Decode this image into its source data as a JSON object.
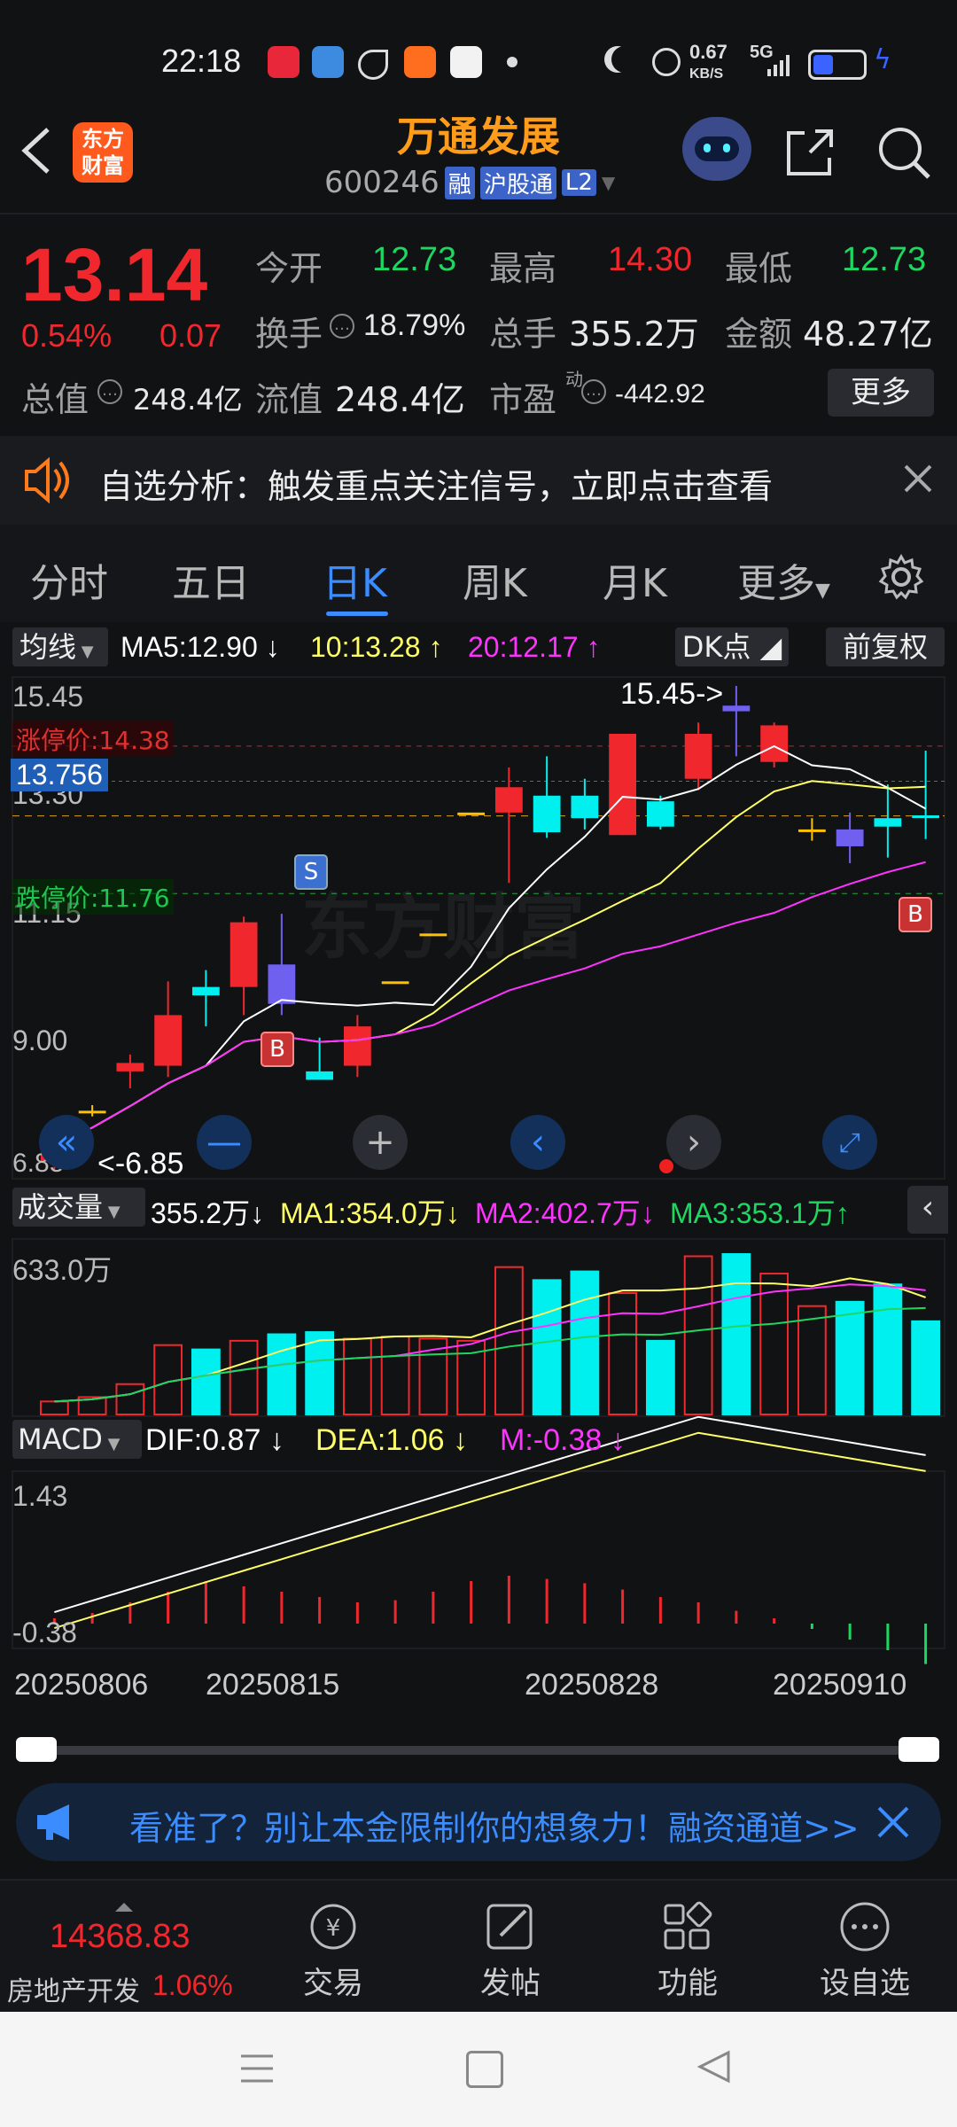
{
  "status": {
    "time": "22:18",
    "net_speed": "0.67",
    "net_unit": "KB/S",
    "net_type": "5G"
  },
  "header": {
    "title": "万通发展",
    "code": "600246",
    "tag_rong": "融",
    "tag_hgt": "沪股通",
    "tag_l2": "L2"
  },
  "quote": {
    "price": "13.14",
    "change_pct": "0.54%",
    "change": "0.07",
    "open_label": "今开",
    "open": "12.73",
    "high_label": "最高",
    "high": "14.30",
    "low_label": "最低",
    "low": "12.73",
    "turnover_label": "换手",
    "turnover": "18.79%",
    "volume_label": "总手",
    "volume": "355.2万",
    "amount_label": "金额",
    "amount": "48.27亿",
    "mktcap_label": "总值",
    "mktcap": "248.4亿",
    "float_label": "流值",
    "float": "248.4亿",
    "pe_label": "市盈",
    "pe_sup": "动",
    "pe": "-442.92",
    "more_label": "更多"
  },
  "banner": {
    "text": "自选分析：触发重点关注信号，立即点击查看"
  },
  "tabs": [
    "分时",
    "五日",
    "日K",
    "周K",
    "月K",
    "更多"
  ],
  "active_tab": "日K",
  "kline": {
    "ma_selector": "均线",
    "ma5": "MA5:12.90",
    "ma10": "10:13.28",
    "ma20": "20:12.17",
    "dk_label": "DK点",
    "fuquan_label": "前复权",
    "price_top": "15.45",
    "price_mid1": "13.30",
    "price_mid2": "11.15",
    "price_mid3": "9.00",
    "price_bottom": "6.85",
    "limit_up": "涨停价:14.38",
    "limit_down": "跌停价:11.76",
    "current_marker": "13.756",
    "max_label": "15.45->",
    "min_label": "<-6.85",
    "watermark": "东方财富",
    "signal_s": "S",
    "signal_b": "B"
  },
  "volume": {
    "selector": "成交量",
    "value": "355.2万",
    "ma1": "MA1:354.0万",
    "ma2": "MA2:402.7万",
    "ma3": "MA3:353.1万",
    "axis_max": "633.0万"
  },
  "macd": {
    "selector": "MACD",
    "dif": "DIF:0.87",
    "dea": "DEA:1.06",
    "m": "M:-0.38",
    "axis_max": "1.43",
    "axis_min": "-0.38"
  },
  "dates": [
    "20250806",
    "20250815",
    "20250828",
    "20250910"
  ],
  "ad": {
    "text": "看准了？别让本金限制你的想象力！融资通道>>"
  },
  "bottom": {
    "index_value": "14368.83",
    "index_name": "房地产开发",
    "index_change": "1.06%",
    "trade": "交易",
    "post": "发帖",
    "func": "功能",
    "watch": "设自选"
  },
  "chart_data": {
    "type": "candlestick",
    "ohlc": [
      [
        7.0,
        7.6,
        6.85,
        7.3
      ],
      [
        7.9,
        8.0,
        7.8,
        7.9
      ],
      [
        8.6,
        8.9,
        8.3,
        8.75
      ],
      [
        8.7,
        10.2,
        8.5,
        9.6
      ],
      [
        10.1,
        10.4,
        9.4,
        9.95
      ],
      [
        10.1,
        11.35,
        9.6,
        11.25
      ],
      [
        10.5,
        11.4,
        9.6,
        9.8
      ],
      [
        8.6,
        9.2,
        8.5,
        8.45
      ],
      [
        8.7,
        9.6,
        8.5,
        9.4
      ],
      [
        10.2,
        10.2,
        10.2,
        10.2
      ],
      [
        11.05,
        11.05,
        11.05,
        11.05
      ],
      [
        13.2,
        13.2,
        13.2,
        13.2
      ],
      [
        13.2,
        14.0,
        11.95,
        13.65
      ],
      [
        13.5,
        14.2,
        12.75,
        12.85
      ],
      [
        13.5,
        13.8,
        12.9,
        13.1
      ],
      [
        12.8,
        14.6,
        12.8,
        14.6
      ],
      [
        13.4,
        13.5,
        12.9,
        12.95
      ],
      [
        13.8,
        14.8,
        13.6,
        14.6
      ],
      [
        15.1,
        15.45,
        14.2,
        15.0
      ],
      [
        14.1,
        14.8,
        14.0,
        14.75
      ],
      [
        12.9,
        13.1,
        12.7,
        12.9
      ],
      [
        12.9,
        13.2,
        12.3,
        12.6
      ],
      [
        13.1,
        13.7,
        12.4,
        12.95
      ],
      [
        13.15,
        14.3,
        12.73,
        13.14
      ]
    ],
    "volume": [
      30,
      40,
      70,
      160,
      150,
      170,
      185,
      190,
      175,
      180,
      175,
      170,
      340,
      310,
      330,
      280,
      170,
      365,
      370,
      325,
      250,
      260,
      300,
      215
    ],
    "macd_hist": [
      0.05,
      0.1,
      0.2,
      0.3,
      0.4,
      0.35,
      0.3,
      0.25,
      0.2,
      0.22,
      0.3,
      0.4,
      0.45,
      0.42,
      0.38,
      0.32,
      0.25,
      0.2,
      0.12,
      0.05,
      -0.05,
      -0.15,
      -0.25,
      -0.38
    ],
    "dates": [
      "20250806",
      "20250815",
      "20250828",
      "20250910"
    ],
    "ylim": [
      6.85,
      15.45
    ]
  },
  "colors": {
    "up": "#f0282d",
    "down": "#00f0f0",
    "flat": "#ffc000",
    "ma5": "#ffffff",
    "ma10": "#ffff66",
    "ma20": "#ff33ff",
    "accent": "#3b8cff",
    "orange": "#ff9c1a"
  }
}
